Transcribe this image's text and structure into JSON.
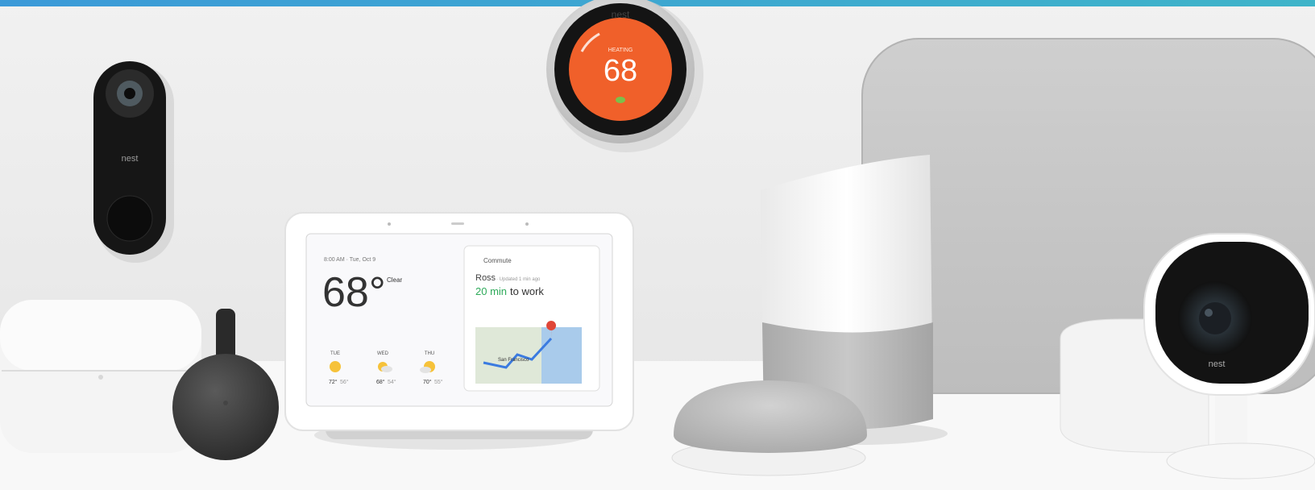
{
  "image": {
    "top_bar_color": "#3a9fd6",
    "wall_color": "#ececec",
    "table_color": "#f7f7f7"
  },
  "doorbell": {
    "logo": "nest"
  },
  "thermostat": {
    "logo": "nest",
    "mode": "HEATING",
    "temperature": "68",
    "ring_color": "#f0602a"
  },
  "hub": {
    "time_date": "8:00 AM · Tue, Oct 9",
    "temperature": "68°",
    "condition": "Clear",
    "forecast": [
      {
        "day": "TUE",
        "hi": "72°",
        "lo": "56°",
        "icon": "sun-icon"
      },
      {
        "day": "WED",
        "hi": "68°",
        "lo": "54°",
        "icon": "partly-sunny-icon"
      },
      {
        "day": "THU",
        "hi": "70°",
        "lo": "55°",
        "icon": "partly-sunny-icon"
      }
    ],
    "commute": {
      "header": "Commute",
      "person": "Ross",
      "updated": "· Updated 1 min ago",
      "time": "20 min",
      "destination": "to work",
      "map_label": "San Francisco"
    }
  },
  "camera": {
    "logo": "nest"
  }
}
